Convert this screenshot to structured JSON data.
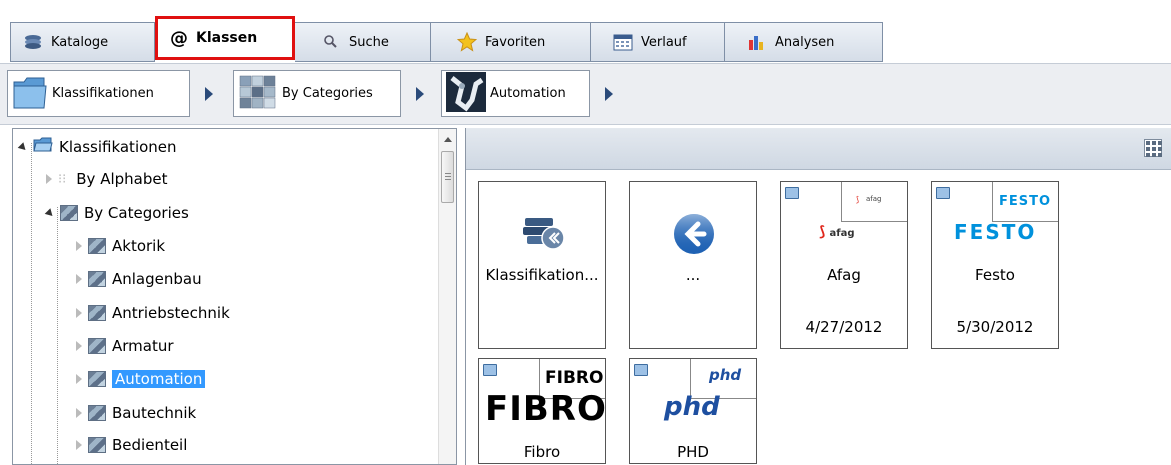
{
  "tabs": [
    {
      "label": "Kataloge",
      "icon": "catalog-stack-icon"
    },
    {
      "label": "Klassen",
      "icon": "at-icon",
      "prefix": "@"
    },
    {
      "label": "Suche",
      "icon": "search-icon"
    },
    {
      "label": "Favoriten",
      "icon": "star-icon"
    },
    {
      "label": "Verlauf",
      "icon": "calendar-icon"
    },
    {
      "label": "Analysen",
      "icon": "bar-chart-icon"
    }
  ],
  "breadcrumb": [
    {
      "label": "Klassifikationen",
      "icon": "folder-icon"
    },
    {
      "label": "By Categories",
      "icon": "categories-icon"
    },
    {
      "label": "Automation",
      "icon": "automation-icon"
    }
  ],
  "tree": {
    "items": [
      {
        "label": "Klassifikationen",
        "level": 0,
        "expanded": true,
        "icon": "folder-open-icon"
      },
      {
        "label": "By Alphabet",
        "level": 1,
        "expanded": false,
        "icon": "alphabet-icon"
      },
      {
        "label": "By Categories",
        "level": 1,
        "expanded": true,
        "icon": "category-icon"
      },
      {
        "label": "Aktorik",
        "level": 2,
        "expanded": false,
        "icon": "category-icon"
      },
      {
        "label": "Anlagenbau",
        "level": 2,
        "expanded": false,
        "icon": "category-icon"
      },
      {
        "label": "Antriebstechnik",
        "level": 2,
        "expanded": false,
        "icon": "category-icon"
      },
      {
        "label": "Armatur",
        "level": 2,
        "expanded": false,
        "icon": "category-icon"
      },
      {
        "label": "Automation",
        "level": 2,
        "expanded": false,
        "icon": "category-icon",
        "selected": true
      },
      {
        "label": "Bautechnik",
        "level": 2,
        "expanded": false,
        "icon": "category-icon"
      },
      {
        "label": "Bedienteil",
        "level": 2,
        "expanded": false,
        "icon": "category-icon"
      }
    ]
  },
  "tiles": [
    {
      "label": "Klassifikation...",
      "date": "",
      "icon": "books-back-icon"
    },
    {
      "label": "...",
      "date": "",
      "icon": "back-arrow-icon"
    },
    {
      "label": "Afag",
      "date": "4/27/2012",
      "logo_text": "afag",
      "logo_small": "afag"
    },
    {
      "label": "Festo",
      "date": "5/30/2012",
      "logo_text": "FESTO",
      "logo_small": "FESTO"
    },
    {
      "label": "Fibro",
      "date": "",
      "logo_text": "FIBRO",
      "logo_small": "FIBRO"
    },
    {
      "label": "PHD",
      "date": "",
      "logo_text": "phd",
      "logo_small": "phd"
    }
  ],
  "colors": {
    "active_tab_border": "#e01010",
    "selection": "#3399ff",
    "festo_blue": "#0091dc",
    "afag_red": "#e0261b",
    "phd_blue": "#1e4fa0"
  }
}
